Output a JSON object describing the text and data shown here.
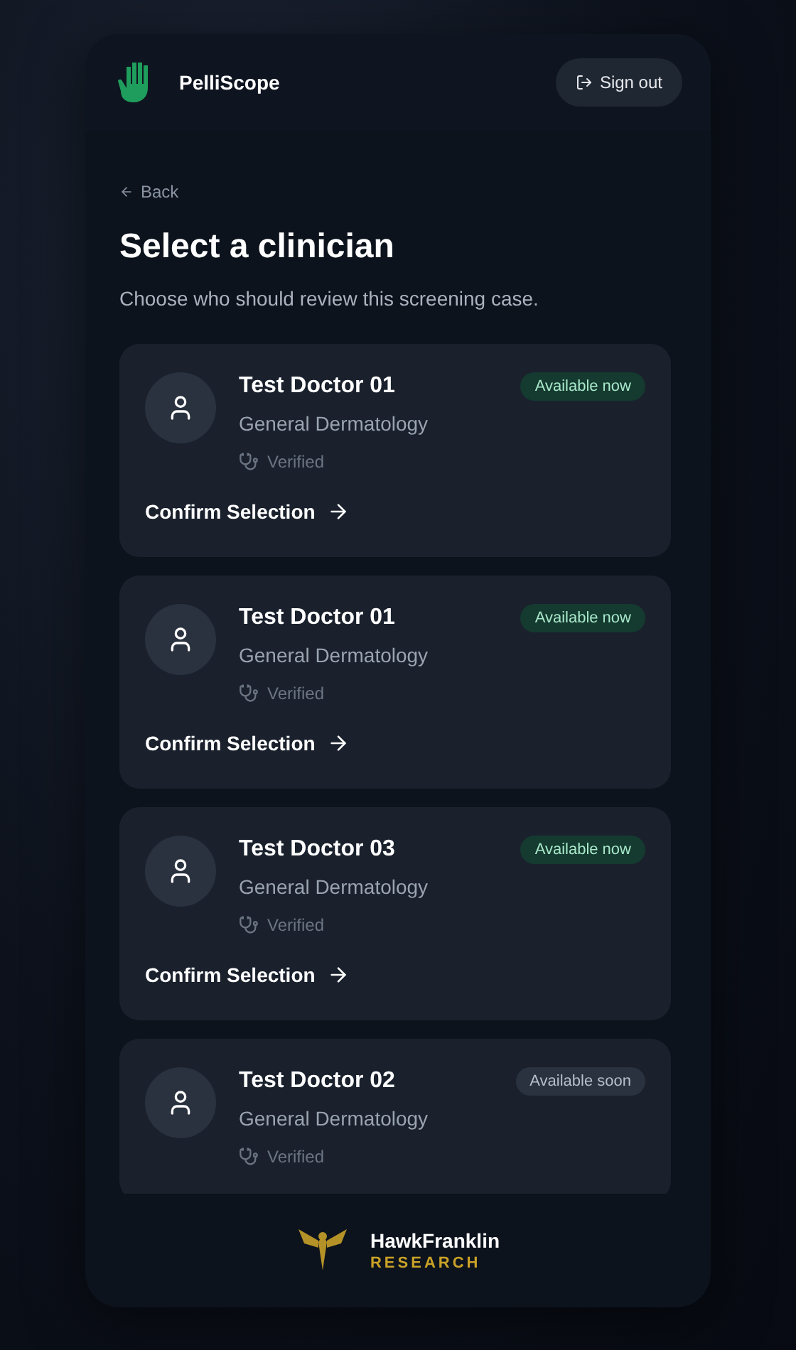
{
  "header": {
    "app_name": "PelliScope",
    "sign_out": "Sign out"
  },
  "back": "Back",
  "title": "Select a clinician",
  "subtitle": "Choose who should review this screening case.",
  "clinicians": [
    {
      "name": "Test Doctor 01",
      "specialty": "General Dermatology",
      "verified": "Verified",
      "badge": {
        "text": "Available now",
        "kind": "now"
      },
      "confirm": "Confirm Selection"
    },
    {
      "name": "Test Doctor 01",
      "specialty": "General Dermatology",
      "verified": "Verified",
      "badge": {
        "text": "Available now",
        "kind": "now"
      },
      "confirm": "Confirm Selection"
    },
    {
      "name": "Test Doctor 03",
      "specialty": "General Dermatology",
      "verified": "Verified",
      "badge": {
        "text": "Available now",
        "kind": "now"
      },
      "confirm": "Confirm Selection"
    },
    {
      "name": "Test Doctor 02",
      "specialty": "General Dermatology",
      "verified": "Verified",
      "badge": {
        "text": "Available soon",
        "kind": "soon"
      }
    }
  ],
  "footer": {
    "brand": "HawkFranklin",
    "tagline": "RESEARCH"
  }
}
